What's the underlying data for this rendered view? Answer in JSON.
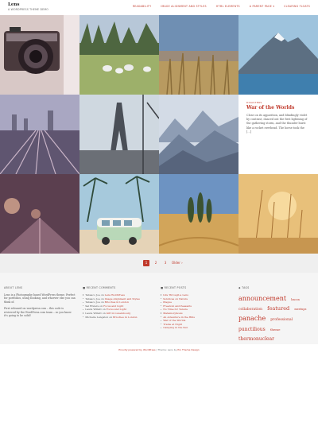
{
  "site": {
    "title": "Lens",
    "description": "A WordPress Theme Demo"
  },
  "nav": [
    "Readability",
    "Image Alignment and Styles",
    "HTML Elements",
    "A Parent Page",
    "Clearing Floats"
  ],
  "nav_dropdown_marker": "▾",
  "featured_post": {
    "category": "Disasters",
    "title": "War of the Worlds",
    "excerpt": "Close on its apparition, and blindingly violet by contrast, danced out the first lightning of the gathering storm, and the thunder burst like a rocket overhead. The horse took the […]"
  },
  "pagination": {
    "pages": [
      "1",
      "2",
      "3"
    ],
    "current": "1",
    "older": "Older ›"
  },
  "widgets": {
    "about": {
      "title": "About Lens",
      "paragraphs": [
        "Lens is a Photography based WordPress theme. Perfect for portfolios, using booking, and whoever else you can think of.",
        "First released on wordpress.com – this code is reviewed by the WordPress.com team – so you know it's going to be solid!"
      ]
    },
    "recent_comments": {
      "title": "Recent Comments",
      "items": [
        {
          "author": "Tabasco Joe",
          "post": "Lens WordPress"
        },
        {
          "author": "Tabasco Joe",
          "post": "Image Alignment and Styles"
        },
        {
          "author": "Tabasco Joe",
          "post": "Brioches in London"
        },
        {
          "author": "Sal Riviere",
          "post": "Focus and Light"
        },
        {
          "author": "Laura Willett",
          "post": "Focus and Light"
        },
        {
          "author": "Laura Willett",
          "post": "Gift in Luxembourg"
        },
        {
          "author": "Michelle Langston",
          "post": "Brioches in London"
        }
      ]
    },
    "recent_posts": {
      "title": "Recent Posts",
      "items": [
        "Life Through a Lens",
        "Solstices on Nature",
        "Plague",
        "Freedom and Peasants",
        "No Time for Tenure",
        "Metamorphosis",
        "An Adventure in the Hills",
        "War of the Worlds",
        "Trains at Night",
        "Camping in the Sun"
      ]
    },
    "tags": {
      "title": "Tags",
      "items": [
        {
          "label": "announcement",
          "weight": 3
        },
        {
          "label": "bacon",
          "weight": 1
        },
        {
          "label": "collaboration",
          "weight": 1
        },
        {
          "label": "featured",
          "weight": 2
        },
        {
          "label": "meetups",
          "weight": 1
        },
        {
          "label": "panache",
          "weight": 3
        },
        {
          "label": "professional",
          "weight": 1
        },
        {
          "label": "punctilious",
          "weight": 2
        },
        {
          "label": "theme",
          "weight": 1
        },
        {
          "label": "thermonuclear",
          "weight": 2
        }
      ]
    }
  },
  "footer": {
    "prefix": "Proudly powered by WordPress",
    "middle": " | Theme: Lens by ",
    "author": "Pro Theme Design"
  },
  "colors": {
    "accent": "#c0392b",
    "pager_bg": "#efefef"
  }
}
